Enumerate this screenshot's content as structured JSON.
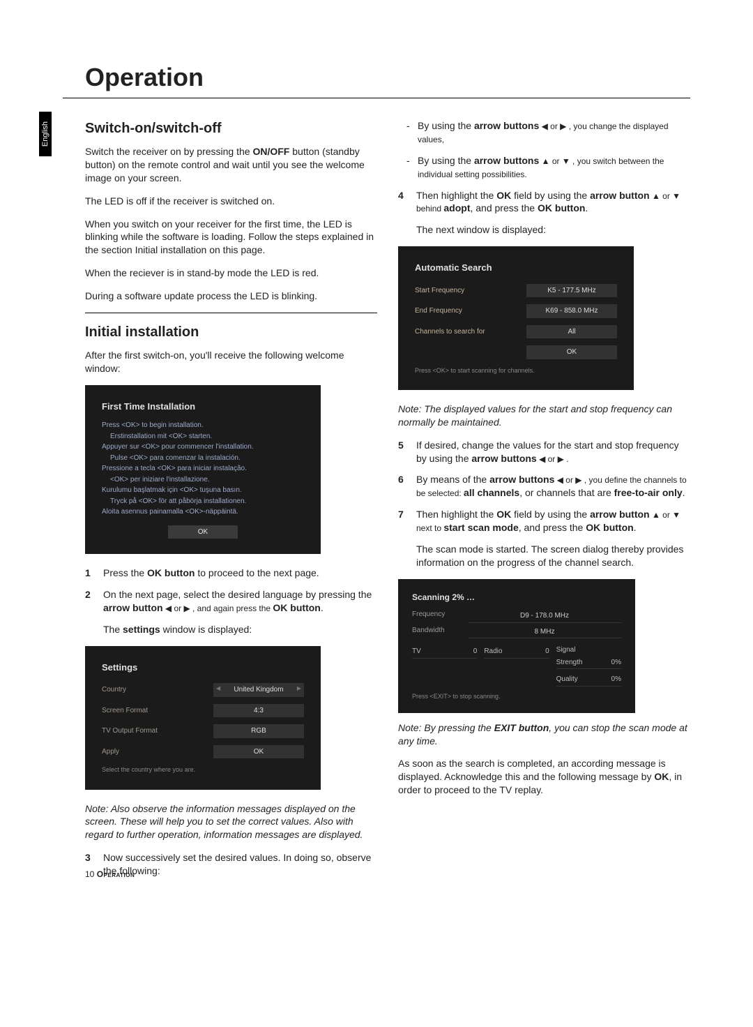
{
  "sideTab": "English",
  "pageTitle": "Operation",
  "left": {
    "switch": {
      "heading": "Switch-on/switch-off",
      "p1a": "Switch the receiver on by pressing the ",
      "p1b": "ON/OFF",
      "p1c": " button (standby button) on the remote control and wait until you see the welcome image on your screen.",
      "p2": "The LED is off if the receiver is switched on.",
      "p3": "When you switch on your receiver for the first time, the LED is blinking while the software is loading. Follow the steps explained in the section Initial installation on this page.",
      "p4": "When the reciever is in stand-by mode the LED is red.",
      "p5": "During a software update process the LED is blinking."
    },
    "initial": {
      "heading": "Initial installation",
      "p1": "After the first switch-on, you'll receive the following welcome window:"
    },
    "firstTime": {
      "title": "First Time Installation",
      "l1": "Press <OK> to begin installation.",
      "l2": "Erstinstallation mit <OK> starten.",
      "l3": "Appuyer sur <OK> pour commencer l'installation.",
      "l4": "Pulse <OK> para comenzar la instalación.",
      "l5": "Pressione a tecla <OK> para iniciar instalação.",
      "l6": "<OK> per iniziare l'installazione.",
      "l7": "Kurulumu başlatmak için <OK> tuşuna basın.",
      "l8": "Tryck på <OK> för att påbörja installationen.",
      "l9": "Aloita asennus painamalla <OK>-näppäintä.",
      "ok": "OK"
    },
    "step1": {
      "num": "1",
      "a": "Press the ",
      "b": "OK button",
      "c": " to proceed to the next page."
    },
    "step2": {
      "num": "2",
      "a": "On the next page, select the desired language by pressing the ",
      "b": "arrow button",
      "c": " ◀ or ▶ , and again press the ",
      "d": "OK button",
      "e": "."
    },
    "settingsIntro": {
      "a": "The ",
      "b": "settings",
      "c": " window is displayed:"
    },
    "settings": {
      "title": "Settings",
      "r1l": "Country",
      "r1v": "United Kingdom",
      "r2l": "Screen Format",
      "r2v": "4:3",
      "r3l": "TV Output Format",
      "r3v": "RGB",
      "r4l": "Apply",
      "r4v": "OK",
      "hint": "Select the country where you are."
    },
    "note1": "Note:  Also observe the information messages displayed on the screen. These will help you to set the correct values. Also with regard to further operation, information messages are displayed.",
    "step3": {
      "num": "3",
      "text": "Now successively set the desired values. In doing so, observe the following:"
    }
  },
  "right": {
    "b1": {
      "a": "By using the ",
      "b": "arrow buttons",
      "c": " ◀ or ▶ , you change the displayed values,"
    },
    "b2": {
      "a": "By using the ",
      "b": "arrow buttons",
      "c": " ▲ or ▼ , you switch between the individual setting possibilities."
    },
    "step4": {
      "num": "4",
      "a": "Then highlight the ",
      "b": "OK",
      "c": " field by using the ",
      "d": "arrow button",
      "e": " ▲ or ▼ behind ",
      "f": "adopt",
      "g": ", and press the ",
      "h": "OK button",
      "i": "."
    },
    "nextWin": "The next window is displayed:",
    "autoSearch": {
      "title": "Automatic Search",
      "r1l": "Start Frequency",
      "r1v": "K5 - 177.5 MHz",
      "r2l": "End Frequency",
      "r2v": "K69 - 858.0 MHz",
      "r3l": "Channels to search for",
      "r3v": "All",
      "r4v": "OK",
      "hint": "Press <OK> to start scanning for channels."
    },
    "note2": "Note:  The displayed values for the start and stop frequency can normally be maintained.",
    "step5": {
      "num": "5",
      "a": "If desired, change the values for the start and stop frequency by using the ",
      "b": "arrow buttons",
      "c": " ◀ or ▶ ."
    },
    "step6": {
      "num": "6",
      "a": "By means of the ",
      "b": "arrow buttons",
      "c": " ◀ or ▶ , you define the channels to be selected: ",
      "d": "all channels",
      "e": ", or channels that are ",
      "f": "free-to-air only",
      "g": "."
    },
    "step7": {
      "num": "7",
      "a": "Then highlight the ",
      "b": "OK",
      "c": " field by using the ",
      "d": "arrow button",
      "e": " ▲ or ▼ next to ",
      "f": "start scan mode",
      "g": ", and press the ",
      "h": "OK button",
      "i": "."
    },
    "scanStart": "The scan mode is started. The screen dialog thereby provides information on the progress of the channel search.",
    "scan": {
      "title": "Scanning   2% …",
      "freqL": "Frequency",
      "freqV": "D9 - 178.0 MHz",
      "bwL": "Bandwidth",
      "bwV": "8 MHz",
      "tvL": "TV",
      "tvV": "0",
      "radioL": "Radio",
      "radioV": "0",
      "sigL": "Signal",
      "strL": "Strength",
      "strV": "0%",
      "qualL": "Quality",
      "qualV": "0%",
      "hint": "Press <EXIT> to stop scanning."
    },
    "note3": {
      "a": "Note:  By pressing the ",
      "b": "EXIT button",
      "c": ", you can stop the scan mode at any time."
    },
    "last": {
      "a": "As soon as the search is completed, an according message is displayed. Acknowledge this and the following message by ",
      "b": "OK",
      "c": ", in order to proceed to the TV replay."
    }
  },
  "footer": {
    "page": "10",
    "section": "Operation"
  }
}
